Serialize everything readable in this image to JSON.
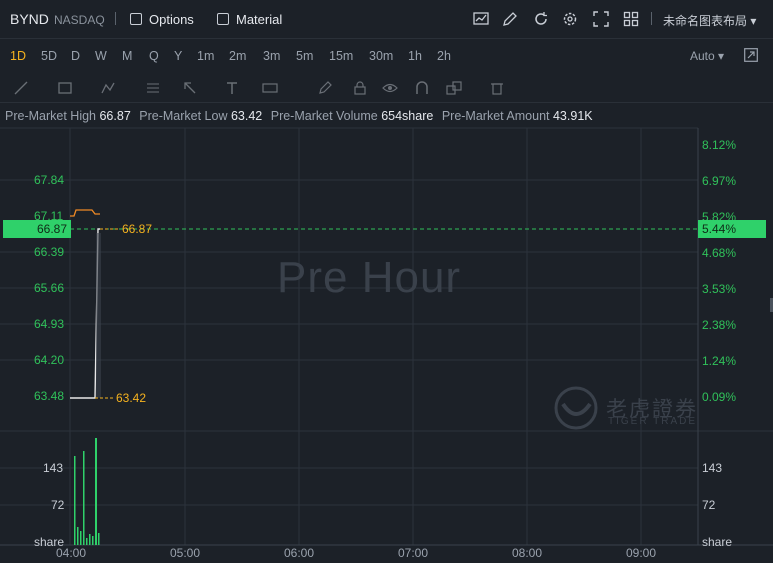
{
  "header": {
    "symbol": "BYND",
    "exchange": "NASDAQ",
    "options_label": "Options",
    "material_label": "Material",
    "layout_name": "未命名图表布局"
  },
  "periods": [
    "1D",
    "5D",
    "D",
    "W",
    "M",
    "Q",
    "Y",
    "1m",
    "2m",
    "3m",
    "5m",
    "15m",
    "30m",
    "1h",
    "2h"
  ],
  "active_period": "1D",
  "auto_label": "Auto",
  "stats": {
    "high_label": "Pre-Market High",
    "high_value": "66.87",
    "low_label": "Pre-Market Low",
    "low_value": "63.42",
    "volume_label": "Pre-Market Volume",
    "volume_value": "654share",
    "amount_label": "Pre-Market Amount",
    "amount_value": "43.91K"
  },
  "watermark": "Pre Hour",
  "logo_text": "老虎證券",
  "logo_sub": "TIGER TRADE",
  "chart_data": {
    "type": "line",
    "y_left_ticks": [
      "67.84",
      "67.11",
      "66.39",
      "65.66",
      "64.93",
      "64.20",
      "63.48"
    ],
    "y_right_ticks": [
      "8.12%",
      "6.97%",
      "5.82%",
      "4.68%",
      "3.53%",
      "2.38%",
      "1.24%",
      "0.09%"
    ],
    "current_price": "66.87",
    "current_pct": "5.44%",
    "high_marker": "66.87",
    "low_marker": "63.42",
    "x_ticks": [
      "04:00",
      "05:00",
      "06:00",
      "07:00",
      "08:00",
      "09:00"
    ],
    "volume_ticks": [
      "143",
      "72",
      "share"
    ],
    "colors": {
      "up": "#30c15a",
      "marker": "#f5b21f",
      "price_line": "#e8e8e8",
      "avg_line": "#f08a24"
    }
  }
}
